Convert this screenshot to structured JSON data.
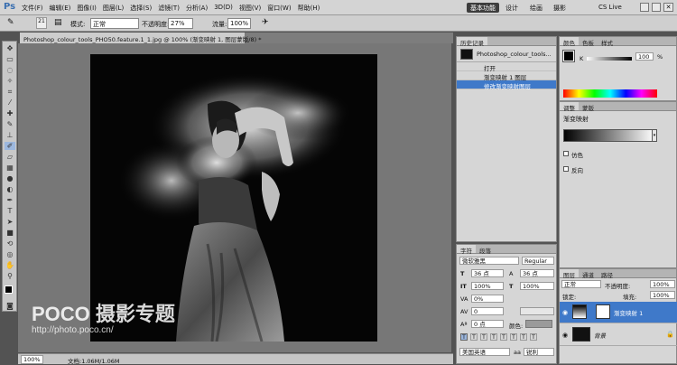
{
  "app": {
    "logo": "Ps"
  },
  "menu": [
    "文件(F)",
    "编辑(E)",
    "图像(I)",
    "图层(L)",
    "选择(S)",
    "滤镜(T)",
    "分析(A)",
    "3D(D)",
    "视图(V)",
    "窗口(W)",
    "帮助(H)"
  ],
  "workspace": {
    "basic": "基本功能",
    "design": "设计",
    "paint": "绘画",
    "photo": "摄影",
    "cslive": "CS Live"
  },
  "options": {
    "brush_size": "21",
    "mode_label": "模式:",
    "mode_value": "正常",
    "opacity_label": "不透明度:",
    "opacity_value": "27%",
    "flow_label": "流量:",
    "flow_value": "100%"
  },
  "document": {
    "tab_title": "Photoshop_colour_tools_PHO50.feature.1_1.jpg @ 100% (渐变映射 1, 图层蒙版/8) *"
  },
  "status": {
    "zoom": "100%",
    "doc_info": "文档:1.06M/1.06M"
  },
  "watermark": {
    "brand": "POCO 摄影专题",
    "url": "http://photo.poco.cn/"
  },
  "history": {
    "tabs": [
      "历史记录"
    ],
    "snapshot": "Photoshop_colour_tools...",
    "items": [
      {
        "label": "打开",
        "selected": false
      },
      {
        "label": "渐变映射 1 图层",
        "selected": false
      },
      {
        "label": "修改渐变映射图层",
        "selected": true
      }
    ]
  },
  "character": {
    "tabs": [
      "字符",
      "段落"
    ],
    "font": "微软雅黑",
    "style": "Regular",
    "size": "36 点",
    "leading": "36 点",
    "vscale": "100%",
    "hscale": "100%",
    "tracking": "0%",
    "kerning": "0",
    "baseline": "0 点",
    "color_label": "颜色:",
    "lang": "美国英语",
    "aa": "锐利"
  },
  "color": {
    "tabs": [
      "颜色",
      "色板",
      "样式"
    ],
    "k_label": "K",
    "k_value": "100",
    "k_unit": "%"
  },
  "adjust": {
    "tabs": [
      "调整",
      "蒙版"
    ],
    "title": "渐变映射",
    "dither": "仿色",
    "reverse": "反向"
  },
  "layers": {
    "tabs": [
      "图层",
      "通道",
      "路径"
    ],
    "blend": "正常",
    "opacity_label": "不透明度:",
    "opacity": "100%",
    "lock_label": "锁定:",
    "fill_label": "填充:",
    "fill": "100%",
    "items": [
      {
        "name": "渐变映射 1",
        "selected": true
      },
      {
        "name": "背景",
        "selected": false
      }
    ]
  },
  "colors": {
    "accent": "#3f79c9",
    "chrome": "#d4d4d4",
    "workspace": "#535353"
  }
}
